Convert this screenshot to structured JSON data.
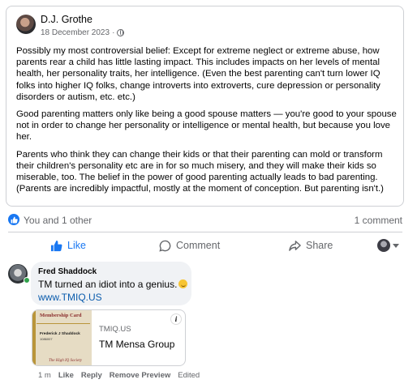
{
  "post": {
    "author": "D.J. Grothe",
    "date": "18 December 2023",
    "meta_separator": "·",
    "paragraphs": [
      "Possibly my most controversial belief: Except for extreme neglect or extreme abuse, how parents rear a child has little lasting impact. This includes impacts on her levels of mental health, her personality traits, her intelligence. (Even the best parenting can't turn lower IQ folks into higher IQ folks, change introverts into extroverts, cure depression or personality disorders or autism, etc. etc.)",
      "Good parenting matters only like being a good spouse matters — you're good to your spouse not in order to change her personality or intelligence or mental health, but because you love her.",
      "Parents who think they can change their kids or that their parenting can mold or transform their children's personality etc are in for so much misery, and they will make their kids so miserable, too. The belief in the power of good parenting actually leads to bad parenting. (Parents are incredibly impactful, mostly at the moment of conception. But parenting isn't.)"
    ]
  },
  "reactions": {
    "summary": "You and 1 other",
    "comments": "1 comment",
    "icon": "thumbs-up-icon",
    "accent_color": "#1877f2"
  },
  "actions": {
    "like": "Like",
    "comment": "Comment",
    "share": "Share"
  },
  "comment": {
    "author": "Fred Shaddock",
    "text": "TM turned an idiot into a genius.",
    "emoji": "smiling-face-icon",
    "link_text": "www.TMIQ.US",
    "link_color": "#0b5cad",
    "preview": {
      "domain": "TMIQ.US",
      "title": "TM Mensa Group",
      "card_header": "Membership Card",
      "card_name": "Frederick J Shaddock",
      "card_number": "1086007",
      "card_footer": "The High IQ Society"
    },
    "time": "1 m",
    "like": "Like",
    "reply": "Reply",
    "remove_preview": "Remove Preview",
    "edited": "Edited"
  }
}
